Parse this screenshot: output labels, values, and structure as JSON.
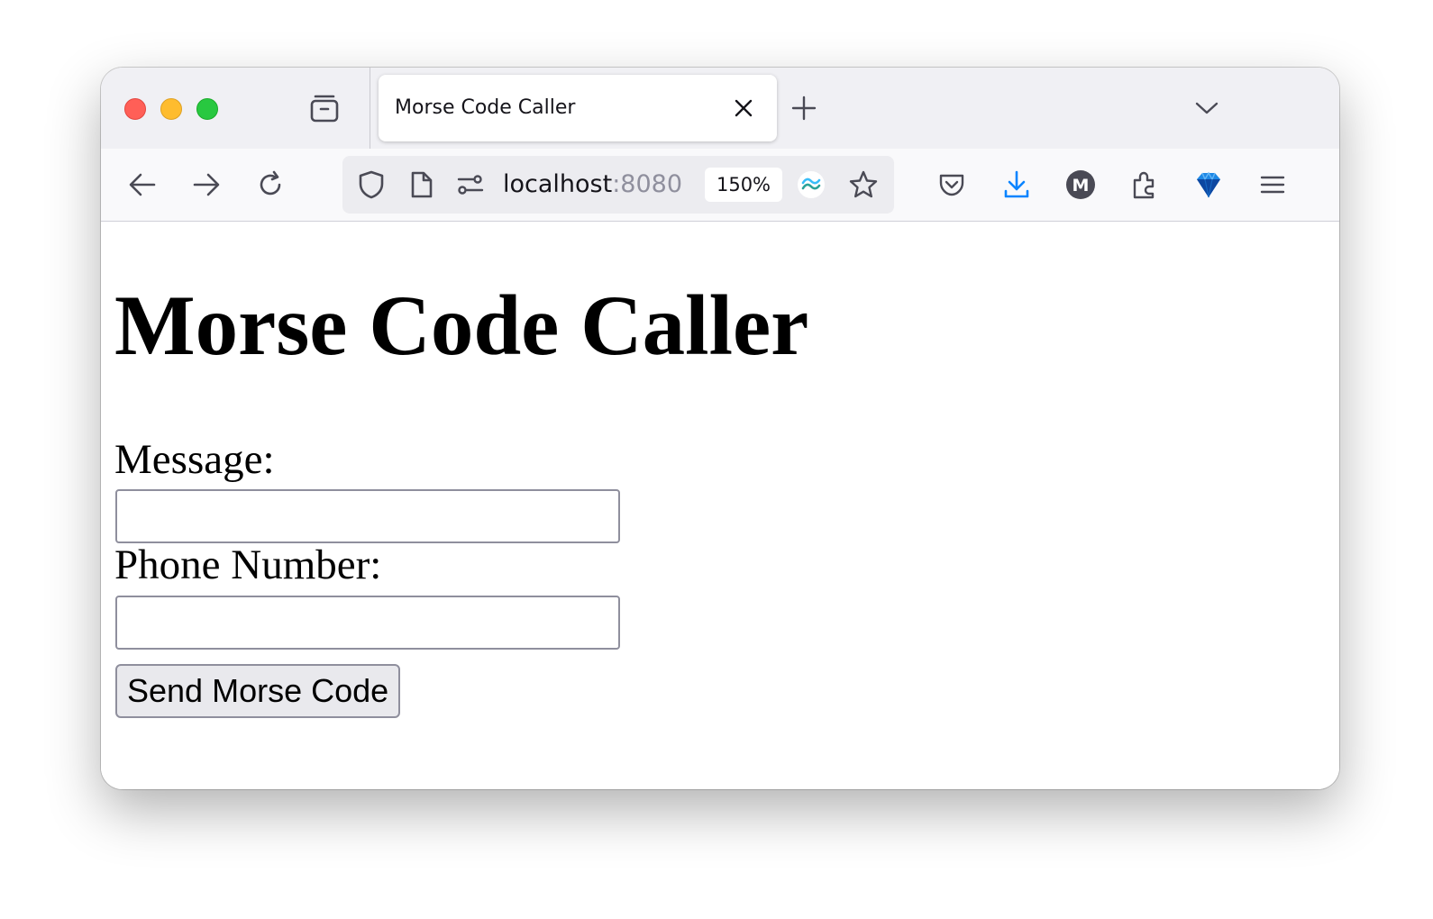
{
  "browser": {
    "tab": {
      "title": "Morse Code Caller"
    },
    "url": {
      "host": "localhost",
      "port": ":8080"
    },
    "zoom": "150%",
    "colors": {
      "close": "#ff5f57",
      "minimize": "#febc2e",
      "zoom": "#28c840",
      "download_accent": "#0a84ff"
    },
    "toolbar_icons": [
      "back-arrow-icon",
      "forward-arrow-icon",
      "reload-icon",
      "shield-icon",
      "page-icon",
      "permissions-icon",
      "tailwind-extension-icon",
      "bookmark-star-icon",
      "pocket-icon",
      "downloads-icon",
      "account-avatar-icon",
      "extensions-icon",
      "gem-extension-icon",
      "menu-icon"
    ],
    "avatar_letter": "M"
  },
  "page": {
    "title": "Morse Code Caller",
    "message_label": "Message:",
    "message_value": "",
    "phone_label": "Phone Number:",
    "phone_value": "",
    "submit_label": "Send Morse Code"
  }
}
